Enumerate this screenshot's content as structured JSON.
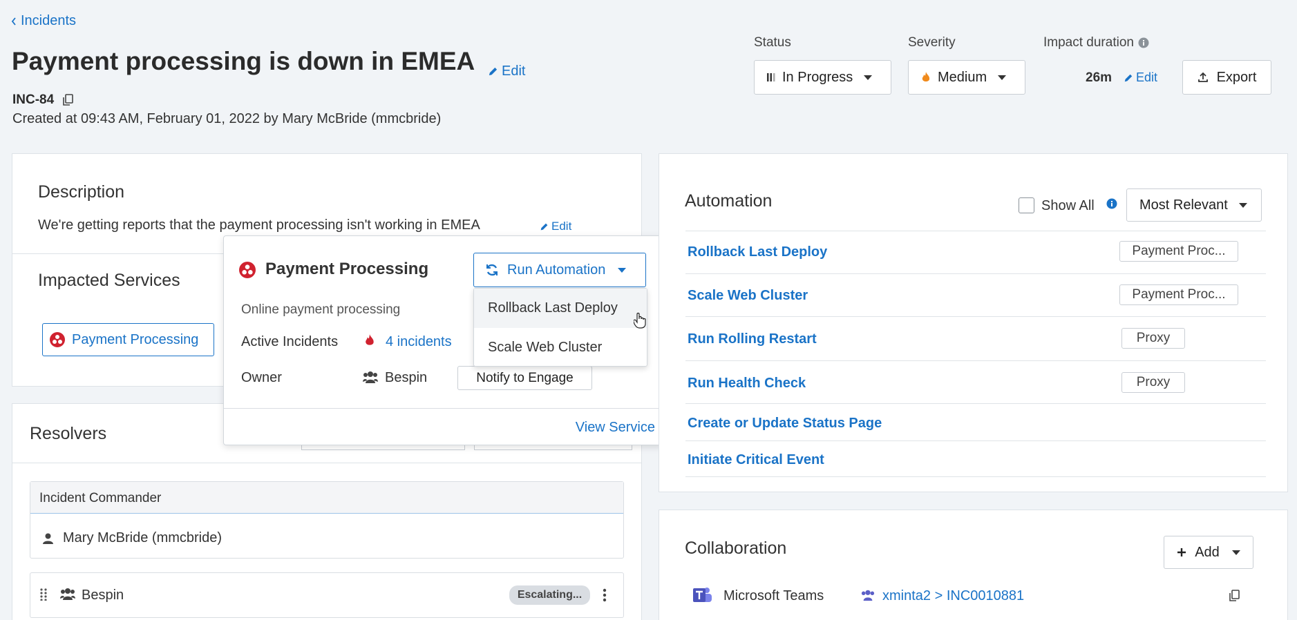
{
  "breadcrumb": {
    "back_label": "Incidents"
  },
  "header": {
    "title": "Payment processing is down in EMEA",
    "edit_label": "Edit",
    "incident_id": "INC-84",
    "created": "Created at 09:43 AM, February 01, 2022 by Mary McBride (mmcbride)"
  },
  "status": {
    "label": "Status",
    "value": "In Progress"
  },
  "severity": {
    "label": "Severity",
    "value": "Medium"
  },
  "impact": {
    "label": "Impact duration",
    "value": "26m",
    "edit_label": "Edit"
  },
  "export_label": "Export",
  "description": {
    "title": "Description",
    "text": "We're getting reports that the payment processing isn't working in EMEA",
    "edit_label": "Edit"
  },
  "impacted": {
    "title": "Impacted Services",
    "service_label": "Payment Processing"
  },
  "popover": {
    "title": "Payment Processing",
    "run_label": "Run Automation",
    "subtitle": "Online payment processing",
    "active_label": "Active Incidents",
    "incidents_link": "4 incidents",
    "owner_label": "Owner",
    "owner_value": "Bespin",
    "notify_label": "Notify to Engage",
    "view_label": "View Service",
    "menu": [
      "Rollback Last Deploy",
      "Scale Web Cluster"
    ]
  },
  "resolvers": {
    "title": "Resolvers",
    "commander_header": "Incident Commander",
    "commander_name": "Mary McBride (mmcbride)",
    "team_name": "Bespin",
    "badge": "Escalating..."
  },
  "automation": {
    "title": "Automation",
    "show_all": "Show All",
    "sort_value": "Most Relevant",
    "items": [
      {
        "label": "Rollback Last Deploy",
        "tag": "Payment Proc..."
      },
      {
        "label": "Scale Web Cluster",
        "tag": "Payment Proc..."
      },
      {
        "label": "Run Rolling Restart",
        "tag": "Proxy"
      },
      {
        "label": "Run Health Check",
        "tag": "Proxy"
      },
      {
        "label": "Create or Update Status Page",
        "tag": ""
      },
      {
        "label": "Initiate Critical Event",
        "tag": ""
      }
    ]
  },
  "collaboration": {
    "title": "Collaboration",
    "add_label": "Add",
    "tool": "Microsoft Teams",
    "channel": "xminta2 > INC0010881"
  },
  "colors": {
    "accent": "#1a73c7",
    "danger": "#d0222f",
    "flame": "#f08a1c"
  }
}
